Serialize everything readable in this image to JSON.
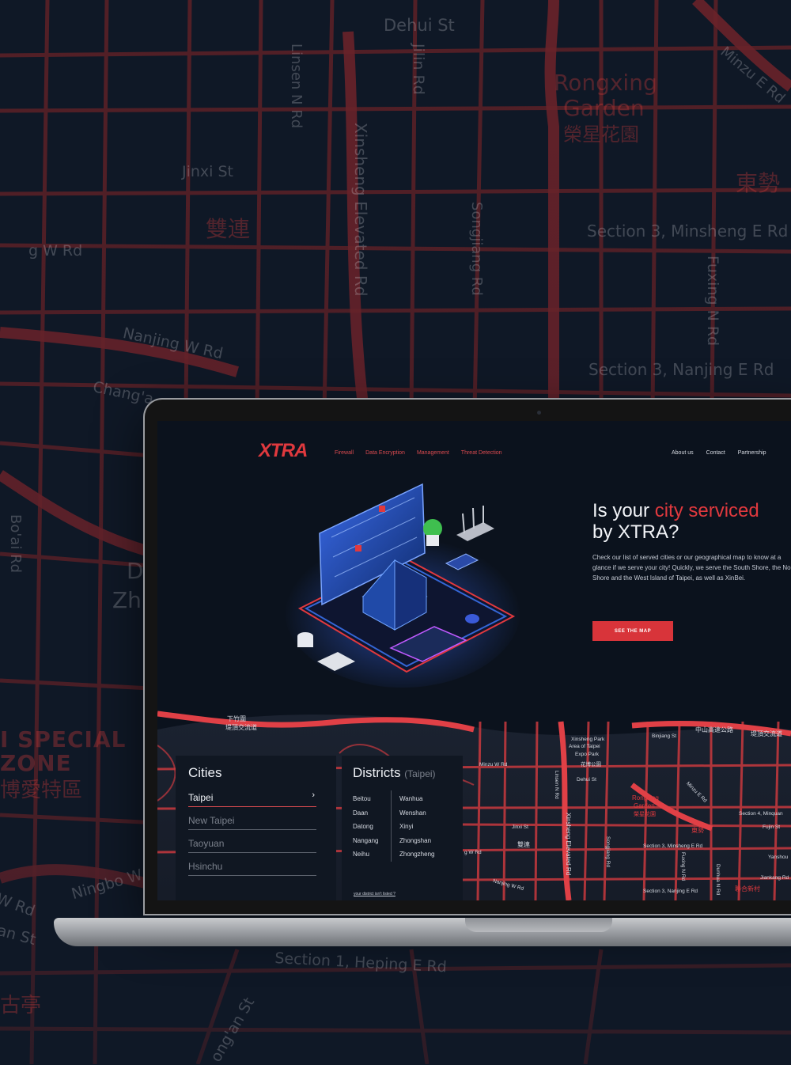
{
  "background_map": {
    "labels": [
      {
        "text": "Dehui St",
        "style": "plain"
      },
      {
        "text": "Linsen N Rd",
        "style": "plain"
      },
      {
        "text": "Jilin Rd",
        "style": "plain"
      },
      {
        "text": "Minzu E Rd",
        "style": "plain"
      },
      {
        "text": "Rongxing",
        "style": "red"
      },
      {
        "text": "Garden",
        "style": "red"
      },
      {
        "text": "榮星花園",
        "style": "red"
      },
      {
        "text": "Jinxi St",
        "style": "plain"
      },
      {
        "text": "東勢",
        "style": "red"
      },
      {
        "text": "雙連",
        "style": "red"
      },
      {
        "text": "Xinsheng Elevated Rd",
        "style": "plain"
      },
      {
        "text": "Songjiang Rd",
        "style": "plain"
      },
      {
        "text": "Section 3, Minsheng E Rd",
        "style": "plain"
      },
      {
        "text": "g W Rd",
        "style": "plain"
      },
      {
        "text": "Fuxing N Rd",
        "style": "plain"
      },
      {
        "text": "Nanjing W Rd",
        "style": "plain"
      },
      {
        "text": "Section 3, Nanjing E Rd",
        "style": "plain"
      },
      {
        "text": "Chang'a",
        "style": "plain"
      },
      {
        "text": "Bo'ai Rd",
        "style": "plain"
      },
      {
        "text": "D",
        "style": "plain"
      },
      {
        "text": "Zh",
        "style": "plain"
      },
      {
        "text": "I SPECIAL",
        "style": "red"
      },
      {
        "text": "ZONE",
        "style": "red"
      },
      {
        "text": "博愛特區",
        "style": "red"
      },
      {
        "text": "Ningbo W",
        "style": "plain"
      },
      {
        "text": "W Rd",
        "style": "plain"
      },
      {
        "text": "an St",
        "style": "plain"
      },
      {
        "text": "Section 1, Heping E Rd",
        "style": "plain"
      },
      {
        "text": "ong'an St",
        "style": "plain"
      },
      {
        "text": "古亭",
        "style": "red"
      }
    ]
  },
  "site": {
    "logo": "XTRA",
    "nav_left": [
      "Firewall",
      "Data Encryption",
      "Management",
      "Threat Detection"
    ],
    "nav_right": [
      "About us",
      "Contact",
      "Partnership"
    ],
    "hero": {
      "title_pre": "Is your ",
      "title_accent": "city serviced",
      "title_line2": "by XTRA?",
      "description": "Check our list of served cities or our geographical map to know at a glance if we serve your city! Quickly, we serve the South Shore, the North Shore and the West Island of Taipei, as well as XinBei.",
      "cta": "SEE THE MAP"
    },
    "cities": {
      "title": "Cities",
      "items": [
        "Taipei",
        "New Taipei",
        "Taoyuan",
        "Hsinchu"
      ],
      "active_index": 0
    },
    "districts": {
      "title": "Districts",
      "subtitle": "(Taipei)",
      "col1": [
        "Beitou",
        "Daan",
        "Datong",
        "Nangang",
        "Neihu"
      ],
      "col2": [
        "Wanhua",
        "Wenshan",
        "Xinyi",
        "Zhongshan",
        "Zhongzheng"
      ],
      "not_listed": "your district isn't listed ?"
    },
    "map_labels": [
      "Xinsheng Park",
      "Area of Taipei",
      "Expo Park",
      "花博公園",
      "Binjiang St",
      "中山高速公路",
      "堤頂交流道",
      "Minzu W Rd",
      "Dehui St",
      "Linsen N Rd",
      "Jinxi St",
      "雙連",
      "g W Rd",
      "Xinsheng Elevated Rd",
      "Songjiang Rd",
      "Rongxing",
      "Garden",
      "榮星花園",
      "Minzu E Rd",
      "東勢",
      "Section 3, Minsheng E Rd",
      "Fuxing N Rd",
      "Dunhua N Rd",
      "Section 4, Minquan",
      "Fujin St",
      "Yanshou",
      "Jiankang Rd",
      "Section 3, Nanjing E Rd",
      "聯合新村",
      "Nanjing W Rd",
      "下竹圍",
      "堤頂交流道"
    ]
  },
  "colors": {
    "accent": "#e0393e",
    "map_road": "#c8393e",
    "background": "#0f1826",
    "screen_bg": "#0b121d"
  }
}
